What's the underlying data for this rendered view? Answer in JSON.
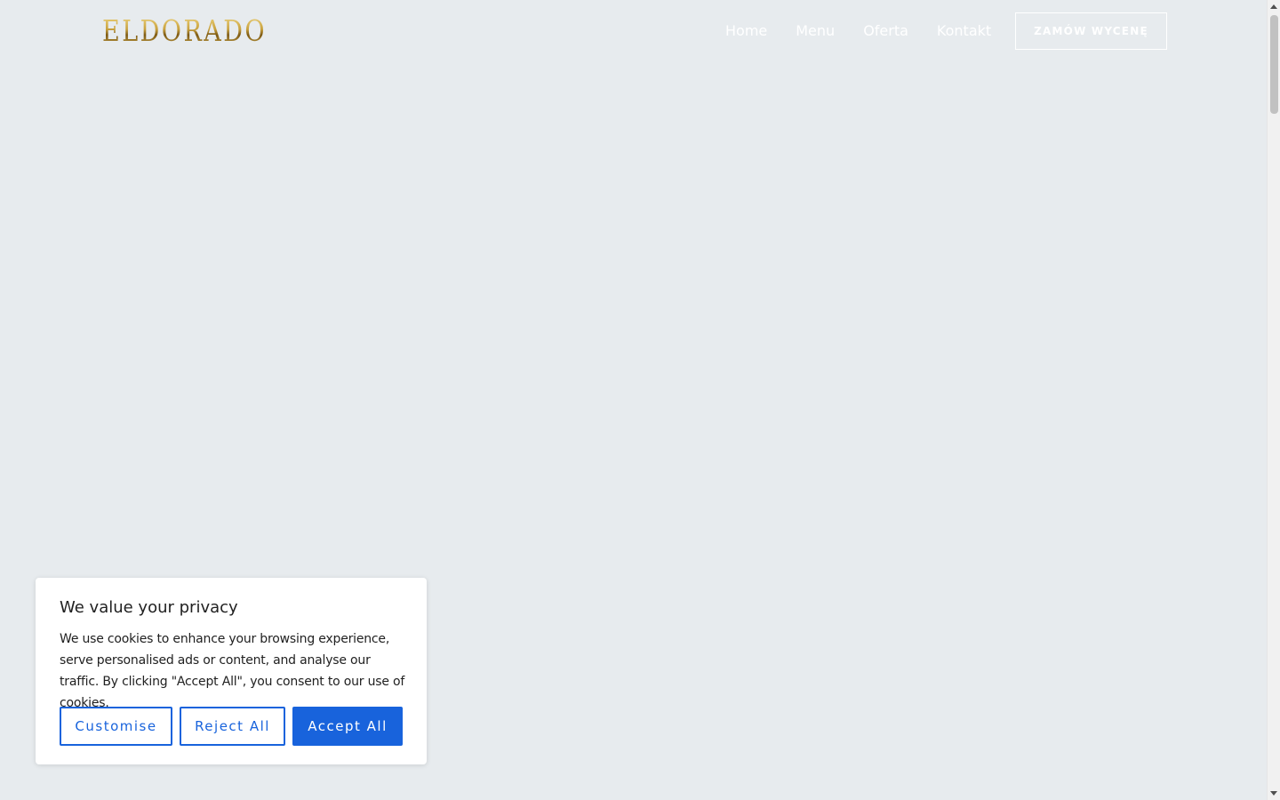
{
  "header": {
    "logo_text": "ELDORADO",
    "nav": [
      {
        "label": "Home"
      },
      {
        "label": "Menu"
      },
      {
        "label": "Oferta"
      },
      {
        "label": "Kontakt"
      }
    ],
    "cta_label": "ZAMÓW WYCENĘ"
  },
  "cookie_banner": {
    "title": "We value your privacy",
    "text": "We use cookies to enhance your browsing experience, serve personalised ads or content, and analyse our traffic. By clicking \"Accept All\", you consent to our use of cookies.",
    "customise_label": "Customise",
    "reject_label": "Reject All",
    "accept_label": "Accept All"
  },
  "colors": {
    "page_background": "#e7ebee",
    "accent": "#1863dc",
    "logo_gold": "#c9a23f"
  }
}
